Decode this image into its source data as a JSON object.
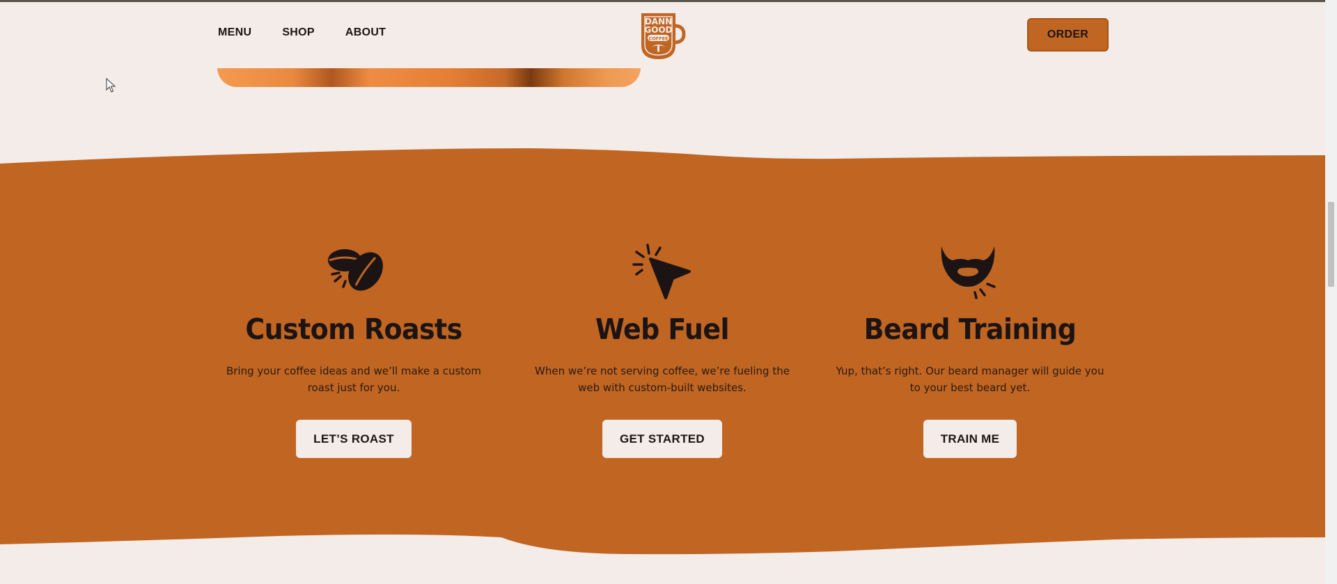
{
  "nav": {
    "items": [
      "MENU",
      "SHOP",
      "ABOUT"
    ],
    "order_label": "ORDER"
  },
  "logo": {
    "line1": "DANN",
    "line2": "GOOD",
    "line3": "COFFEE"
  },
  "features": [
    {
      "icon": "coffee-beans-icon",
      "title": "Custom Roasts",
      "text": "Bring your coffee ideas and we’ll make a custom roast just for you.",
      "button": "LET’S ROAST"
    },
    {
      "icon": "cursor-click-icon",
      "title": "Web Fuel",
      "text": "When we’re not serving coffee, we’re fueling the web with custom-built websites.",
      "button": "GET STARTED"
    },
    {
      "icon": "beard-icon",
      "title": "Beard Training",
      "text": "Yup, that’s right. Our beard manager will guide you to your best beard yet.",
      "button": "TRAIN ME"
    }
  ],
  "colors": {
    "background": "#f3ece9",
    "accent": "#c06522",
    "text": "#1c1414"
  }
}
